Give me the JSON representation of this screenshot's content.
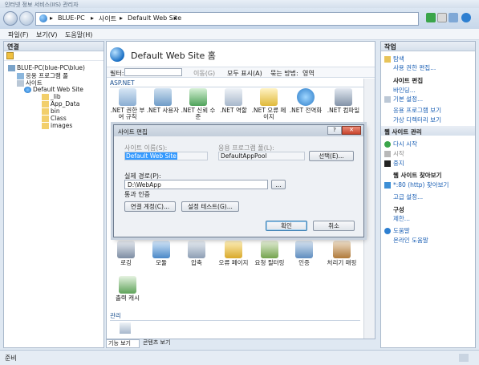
{
  "window": {
    "title": "인터넷 정보 서비스(IIS) 관리자"
  },
  "address": {
    "crumbs": [
      "BLUE-PC",
      "사이트",
      "Default Web Site"
    ],
    "separator": "▸"
  },
  "menu": {
    "items": [
      "파일(F)",
      "보기(V)",
      "도움말(H)"
    ]
  },
  "connections": {
    "header": "연결",
    "tree": [
      {
        "label": "BLUE-PC(blue-PC\\blue)"
      },
      {
        "label": "응용 프로그램 풀"
      },
      {
        "label": "사이트"
      },
      {
        "label": "Default Web Site"
      },
      {
        "label": "_lib"
      },
      {
        "label": "App_Data"
      },
      {
        "label": "bin"
      },
      {
        "label": "Class"
      },
      {
        "label": "images"
      }
    ]
  },
  "main": {
    "title": "Default Web Site 홈",
    "filter_label": "필터:",
    "go_label": "이동(G)",
    "show_all_label": "모두 표시(A)",
    "group_label": "묶는 방법:",
    "group_value": "영역",
    "section_aspnet": "ASP.NET",
    "features_top": [
      {
        "label": ".NET 권한 부여 규칙"
      },
      {
        "label": ".NET 사용자"
      },
      {
        "label": ".NET 신뢰 수준"
      },
      {
        "label": ".NET 역할"
      },
      {
        "label": ".NET 오류 페이지"
      },
      {
        "label": ".NET 전역화"
      },
      {
        "label": ".NET 컴파일"
      }
    ],
    "features_bottom": [
      {
        "label": "로깅"
      },
      {
        "label": "모듈"
      },
      {
        "label": "압축"
      },
      {
        "label": "오류 페이지"
      },
      {
        "label": "요청 필터링"
      },
      {
        "label": "인증"
      },
      {
        "label": "처리기 매핑"
      }
    ],
    "feature_output_cache": "출력 캐시",
    "section_manage": "관리",
    "tab_features": "기능 보기",
    "tab_content": "콘텐츠 보기"
  },
  "dialog": {
    "title": "사이트 편집",
    "help": "?",
    "close": "✕",
    "site_name_label": "사이트 이름(S):",
    "site_name_value": "Default Web Site",
    "app_pool_label": "응용 프로그램 풀(L):",
    "app_pool_value": "DefaultAppPool",
    "select_button": "선택(E)...",
    "physical_path_label": "실제 경로(P):",
    "physical_path_value": "D:\\WebApp",
    "browse_button": "...",
    "pass_through_label": "통과 인증",
    "connect_as_button": "연결 계정(C)...",
    "test_settings_button": "설정 테스트(G)...",
    "ok_button": "확인",
    "cancel_button": "취소"
  },
  "actions": {
    "header": "작업",
    "items": [
      {
        "label": "탐색",
        "type": "link"
      },
      {
        "label": "사용 권한 편집...",
        "type": "link"
      },
      {
        "label": "사이트 편집",
        "type": "heading"
      },
      {
        "label": "바인딩...",
        "type": "link"
      },
      {
        "label": "기본 설정...",
        "type": "link"
      },
      {
        "label": "응용 프로그램 보기",
        "type": "link"
      },
      {
        "label": "가상 디렉터리 보기",
        "type": "link"
      },
      {
        "label": "웹 사이트 관리",
        "type": "section"
      },
      {
        "label": "다시 시작",
        "type": "link"
      },
      {
        "label": "시작",
        "type": "disabled"
      },
      {
        "label": "중지",
        "type": "link"
      },
      {
        "label": "웹 사이트 찾아보기",
        "type": "heading"
      },
      {
        "label": "*:80 (http) 찾아보기",
        "type": "link"
      },
      {
        "label": "고급 설정...",
        "type": "link"
      },
      {
        "label": "구성",
        "type": "heading"
      },
      {
        "label": "제한...",
        "type": "link"
      },
      {
        "label": "도움말",
        "type": "link"
      },
      {
        "label": "온라인 도움말",
        "type": "link"
      }
    ]
  },
  "status": {
    "text": "준비"
  },
  "colors": {
    "accent": "#1a5fb4",
    "selection": "#3399ff"
  }
}
